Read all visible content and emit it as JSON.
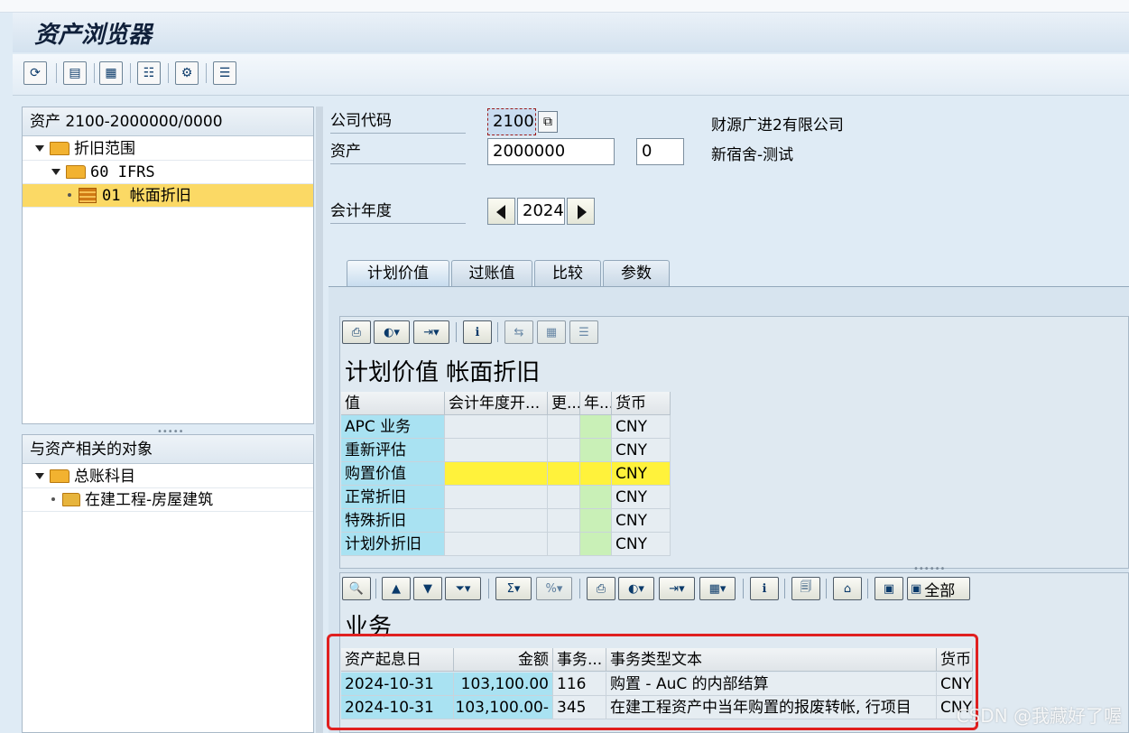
{
  "app": {
    "title": "资产浏览器"
  },
  "toolbar": {
    "icons": [
      "refresh-icon",
      "save-icon",
      "calculate-icon",
      "list-icon",
      "settings-icon",
      "document-icon"
    ]
  },
  "tree": {
    "header": "资产 2100-2000000/0000",
    "items": [
      {
        "label": "折旧范围"
      },
      {
        "label": "60  IFRS"
      },
      {
        "label": "01  帐面折旧"
      }
    ]
  },
  "related": {
    "header": "与资产相关的对象",
    "items": [
      {
        "label": "总账科目"
      },
      {
        "label": "在建工程-房屋建筑"
      }
    ]
  },
  "form": {
    "company_code_label": "公司代码",
    "company_code": "2100",
    "company_name": "财源广进2有限公司",
    "asset_label": "资产",
    "asset_number": "2000000",
    "asset_sub": "0",
    "asset_desc": "新宿舍-测试",
    "fiscal_year_label": "会计年度",
    "fiscal_year": "2024"
  },
  "tabs": [
    "计划价值",
    "过账值",
    "比较",
    "参数"
  ],
  "planned": {
    "title": "计划价值 帐面折旧",
    "columns": [
      "值",
      "会计年度开...",
      "更...",
      "年...",
      "货币"
    ],
    "rows": [
      {
        "label": "APC 业务",
        "currency": "CNY"
      },
      {
        "label": "重新评估",
        "currency": "CNY"
      },
      {
        "label": "购置价值",
        "currency": "CNY"
      },
      {
        "label": "正常折旧",
        "currency": "CNY"
      },
      {
        "label": "特殊折旧",
        "currency": "CNY"
      },
      {
        "label": "计划外折旧",
        "currency": "CNY"
      }
    ]
  },
  "transactions": {
    "title": "业务",
    "columns": [
      "资产起息日",
      "金额",
      "事务...",
      "事务类型文本",
      "货币"
    ],
    "all_label": "全部",
    "rows": [
      {
        "date": "2024-10-31",
        "amount": "103,100.00",
        "type": "116",
        "text": "购置 - AuC 的内部结算",
        "currency": "CNY"
      },
      {
        "date": "2024-10-31",
        "amount": "103,100.00-",
        "type": "345",
        "text": "在建工程资产中当年购置的报废转帐, 行项目",
        "currency": "CNY"
      }
    ]
  },
  "watermark": "CSDN @我藏好了喔"
}
